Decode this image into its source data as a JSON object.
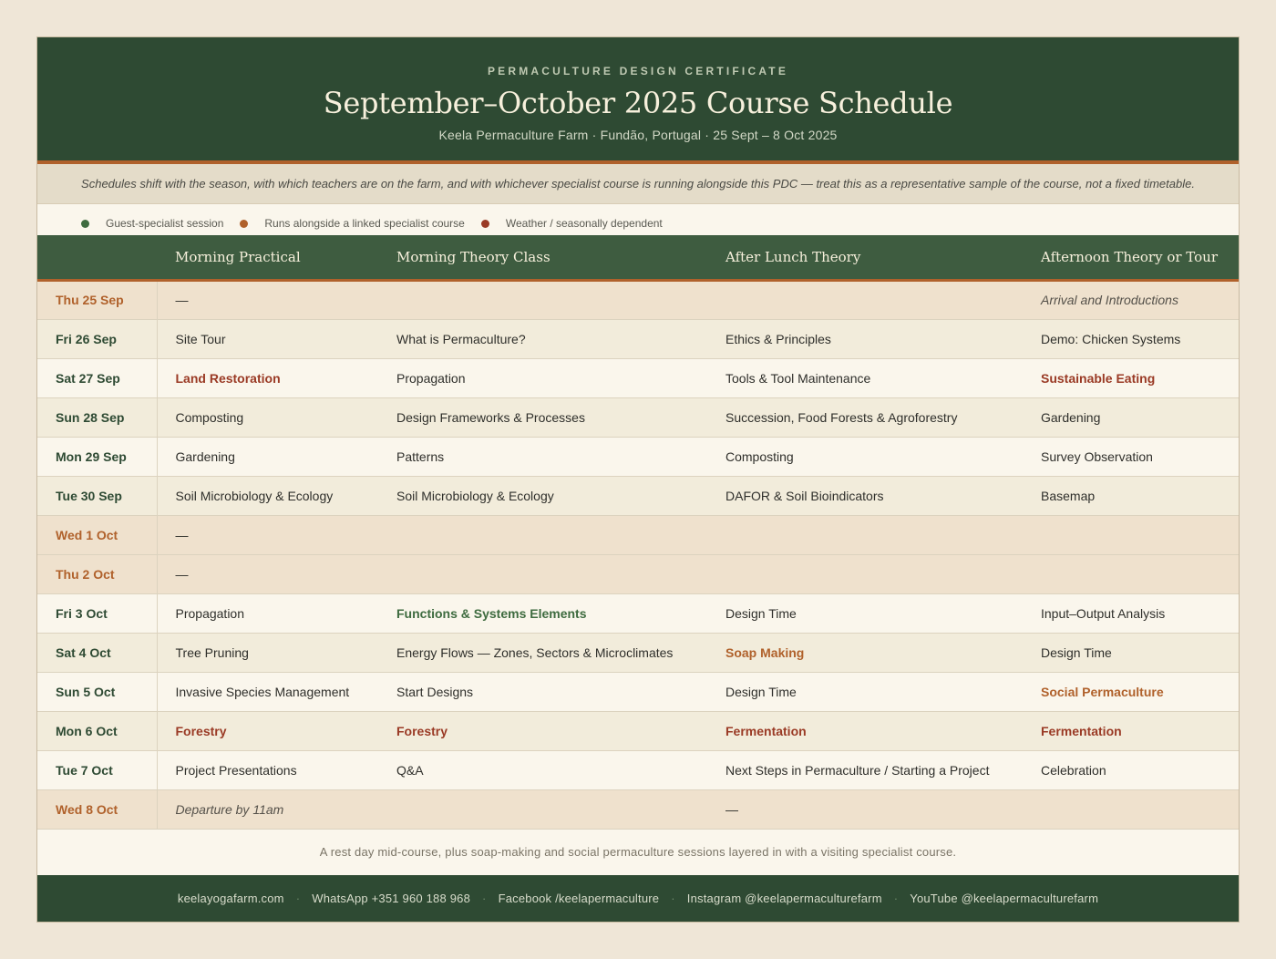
{
  "header": {
    "eyebrow": "PERMACULTURE DESIGN CERTIFICATE",
    "title": "September–October 2025 Course Schedule",
    "subtitle": "Keela Permaculture Farm · Fundão, Portugal · 25 Sept – 8 Oct 2025"
  },
  "note": "Schedules shift with the season, with which teachers are on the farm, and with whichever specialist course is running alongside this PDC — treat this as a representative sample of the course, not a fixed timetable.",
  "legend": [
    {
      "label": "Guest-specialist session",
      "color": "#3e6b3f"
    },
    {
      "label": "Runs alongside a linked specialist course",
      "color": "#b0612b"
    },
    {
      "label": "Weather / seasonally dependent",
      "color": "#9a3a25"
    }
  ],
  "table": {
    "columns": [
      "",
      "Morning Practical",
      "Morning Theory Class",
      "After Lunch Theory",
      "Afternoon Theory or Tour"
    ],
    "rows": [
      {
        "day": "Thu 25 Sep",
        "type": "rest",
        "cells": [
          {
            "text": "—"
          },
          {
            "text": ""
          },
          {
            "text": ""
          },
          {
            "text": "Arrival and Introductions",
            "style": "italic"
          }
        ]
      },
      {
        "day": "Fri 26 Sep",
        "type": "even",
        "cells": [
          {
            "text": "Site Tour"
          },
          {
            "text": "What is Permaculture?"
          },
          {
            "text": "Ethics & Principles"
          },
          {
            "text": "Demo: Chicken Systems"
          }
        ]
      },
      {
        "day": "Sat 27 Sep",
        "type": "odd",
        "cells": [
          {
            "text": "Land Restoration",
            "style": "red"
          },
          {
            "text": "Propagation"
          },
          {
            "text": "Tools & Tool Maintenance"
          },
          {
            "text": "Sustainable Eating",
            "style": "red"
          }
        ]
      },
      {
        "day": "Sun 28 Sep",
        "type": "even",
        "cells": [
          {
            "text": "Composting"
          },
          {
            "text": "Design Frameworks & Processes"
          },
          {
            "text": "Succession, Food Forests & Agroforestry"
          },
          {
            "text": "Gardening"
          }
        ]
      },
      {
        "day": "Mon 29 Sep",
        "type": "odd",
        "cells": [
          {
            "text": "Gardening"
          },
          {
            "text": "Patterns"
          },
          {
            "text": "Composting"
          },
          {
            "text": "Survey Observation"
          }
        ]
      },
      {
        "day": "Tue 30 Sep",
        "type": "even",
        "cells": [
          {
            "text": "Soil Microbiology & Ecology"
          },
          {
            "text": "Soil Microbiology & Ecology"
          },
          {
            "text": "DAFOR & Soil Bioindicators"
          },
          {
            "text": "Basemap"
          }
        ]
      },
      {
        "day": "Wed 1 Oct",
        "type": "rest",
        "cells": [
          {
            "text": "—"
          },
          {
            "text": ""
          },
          {
            "text": ""
          },
          {
            "text": ""
          }
        ]
      },
      {
        "day": "Thu 2 Oct",
        "type": "rest",
        "cells": [
          {
            "text": "—"
          },
          {
            "text": ""
          },
          {
            "text": ""
          },
          {
            "text": ""
          }
        ]
      },
      {
        "day": "Fri 3 Oct",
        "type": "odd",
        "cells": [
          {
            "text": "Propagation"
          },
          {
            "text": "Functions & Systems Elements",
            "style": "green"
          },
          {
            "text": "Design Time"
          },
          {
            "text": "Input–Output Analysis"
          }
        ]
      },
      {
        "day": "Sat 4 Oct",
        "type": "even",
        "cells": [
          {
            "text": "Tree Pruning"
          },
          {
            "text": "Energy Flows — Zones, Sectors & Microclimates"
          },
          {
            "text": "Soap Making",
            "style": "orange"
          },
          {
            "text": "Design Time"
          }
        ]
      },
      {
        "day": "Sun 5 Oct",
        "type": "odd",
        "cells": [
          {
            "text": "Invasive Species Management"
          },
          {
            "text": "Start Designs"
          },
          {
            "text": "Design Time"
          },
          {
            "text": "Social Permaculture",
            "style": "orange"
          }
        ]
      },
      {
        "day": "Mon 6 Oct",
        "type": "even",
        "cells": [
          {
            "text": "Forestry",
            "style": "red"
          },
          {
            "text": "Forestry",
            "style": "red"
          },
          {
            "text": "Fermentation",
            "style": "red"
          },
          {
            "text": "Fermentation",
            "style": "red"
          }
        ]
      },
      {
        "day": "Tue 7 Oct",
        "type": "odd",
        "cells": [
          {
            "text": "Project Presentations"
          },
          {
            "text": "Q&A"
          },
          {
            "text": "Next Steps in Permaculture / Starting a Project"
          },
          {
            "text": "Celebration"
          }
        ]
      },
      {
        "day": "Wed 8 Oct",
        "type": "rest",
        "cells": [
          {
            "text": "Departure by 11am",
            "style": "italic"
          },
          {
            "text": ""
          },
          {
            "text": "—"
          },
          {
            "text": ""
          }
        ]
      }
    ]
  },
  "footnote": "A rest day mid-course, plus soap-making and social permaculture sessions layered in with a visiting specialist course.",
  "footer": {
    "links": [
      "keelayogafarm.com",
      "WhatsApp +351 960 188 968",
      "Facebook /keelapermaculture",
      "Instagram @keelapermaculturefarm",
      "YouTube @keelapermaculturefarm"
    ],
    "separator": "·"
  }
}
